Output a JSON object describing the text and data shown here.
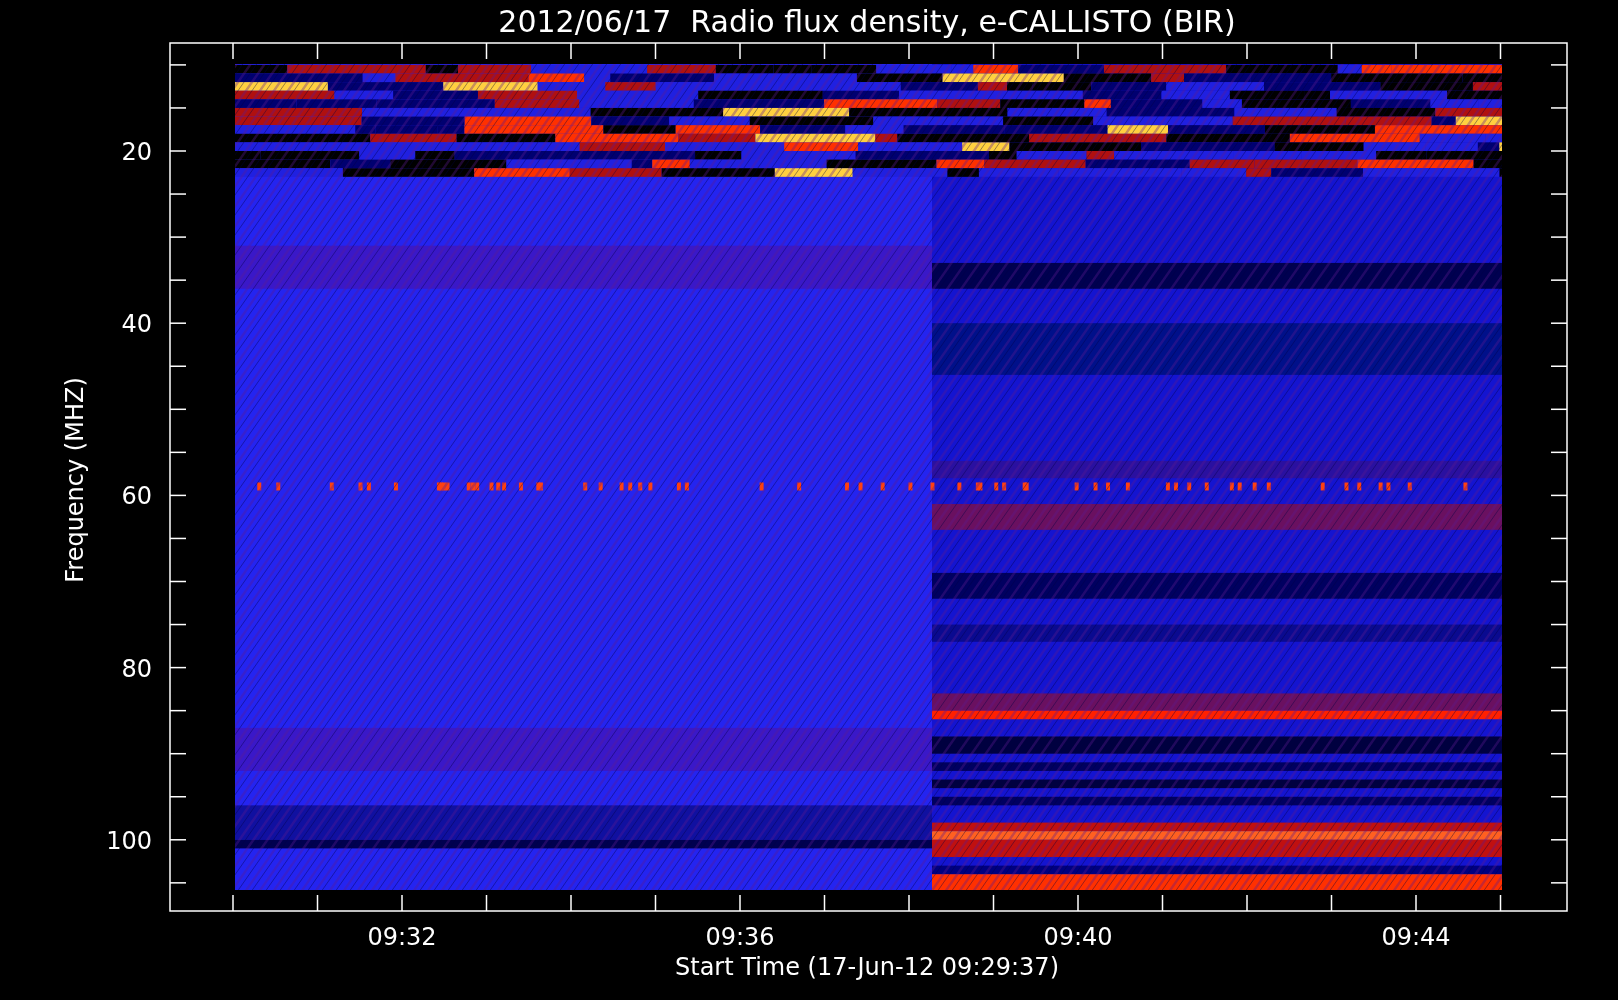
{
  "plot": {
    "title": "2012/06/17  Radio flux density, e-CALLISTO (BIR)",
    "ylabel": "Frequency (MHZ)",
    "xlabel": "Start Time (17-Jun-12 09:29:37)",
    "yticks": [
      "20",
      "40",
      "60",
      "80",
      "100"
    ],
    "xticks": [
      "09:32",
      "09:36",
      "09:40",
      "09:44"
    ]
  }
}
